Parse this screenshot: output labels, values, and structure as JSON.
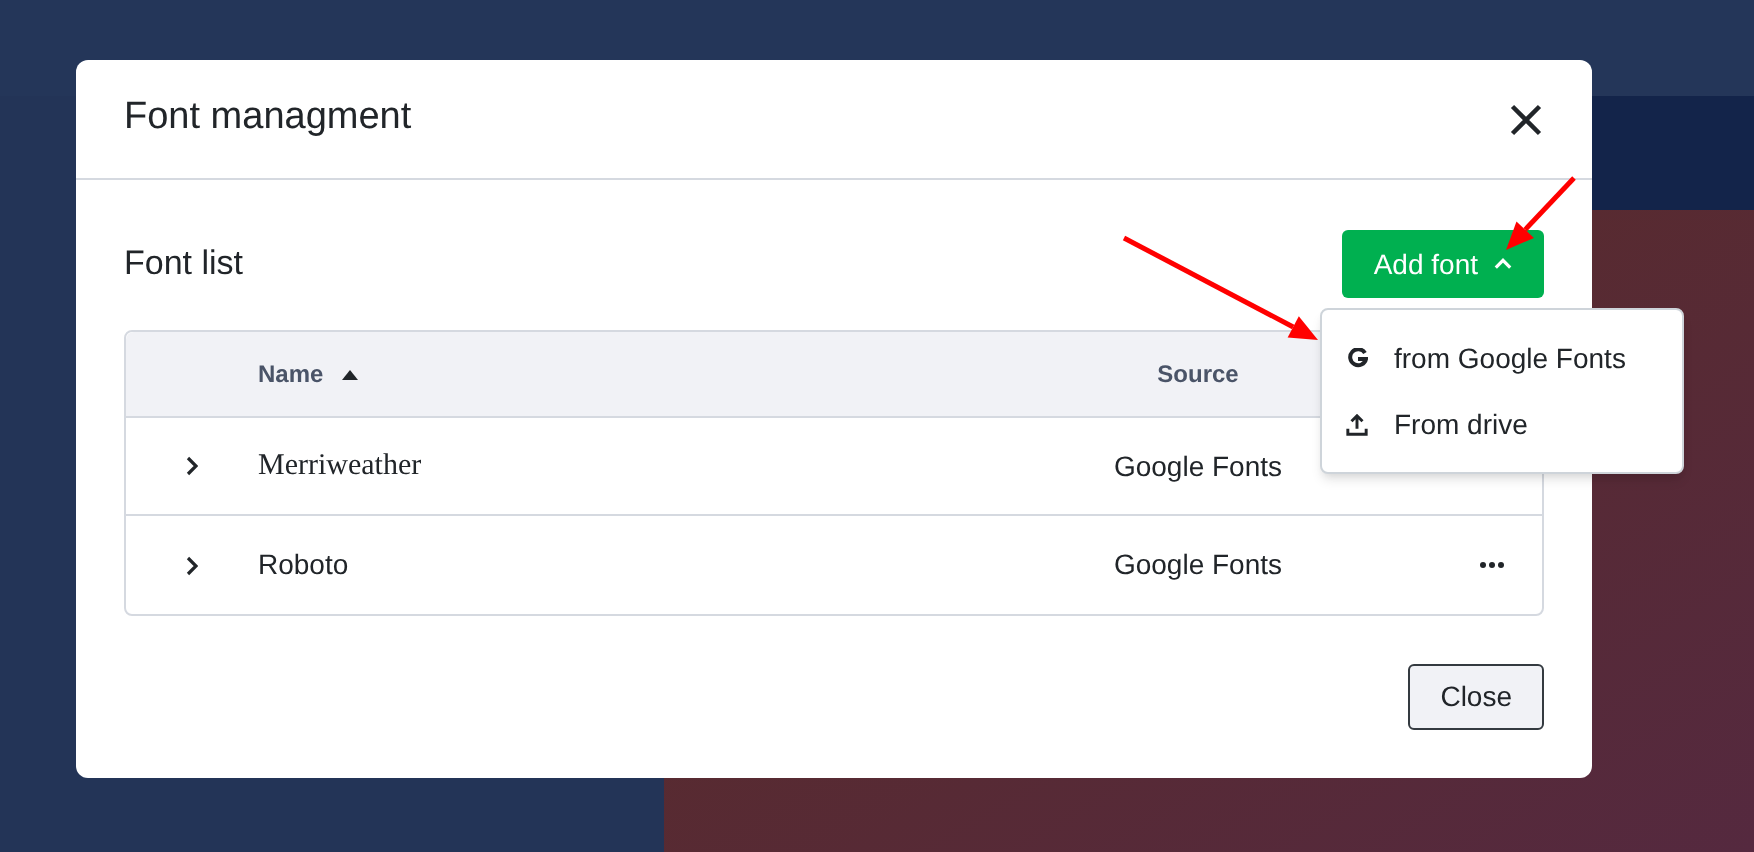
{
  "dialog": {
    "title": "Font managment",
    "section_title": "Font list",
    "add_button": {
      "label": "Add font",
      "expanded": true
    },
    "menu": [
      {
        "kind": "google",
        "label": "from Google Fonts"
      },
      {
        "kind": "upload",
        "label": "From drive"
      }
    ],
    "table": {
      "columns": [
        {
          "label": "Name",
          "sorted": true
        },
        {
          "label": "Source",
          "sorted": false
        }
      ],
      "rows": [
        {
          "name": "Merriweather",
          "kind": "serif",
          "source": "Google Fonts",
          "expanded": false,
          "has_menu": false
        },
        {
          "name": "Roboto",
          "kind": "sans",
          "source": "Google Fonts",
          "expanded": false,
          "has_menu": true
        }
      ]
    },
    "close_button": "Close"
  },
  "annotations": [
    {
      "kind": "arrow"
    },
    {
      "kind": "arrow"
    }
  ]
}
